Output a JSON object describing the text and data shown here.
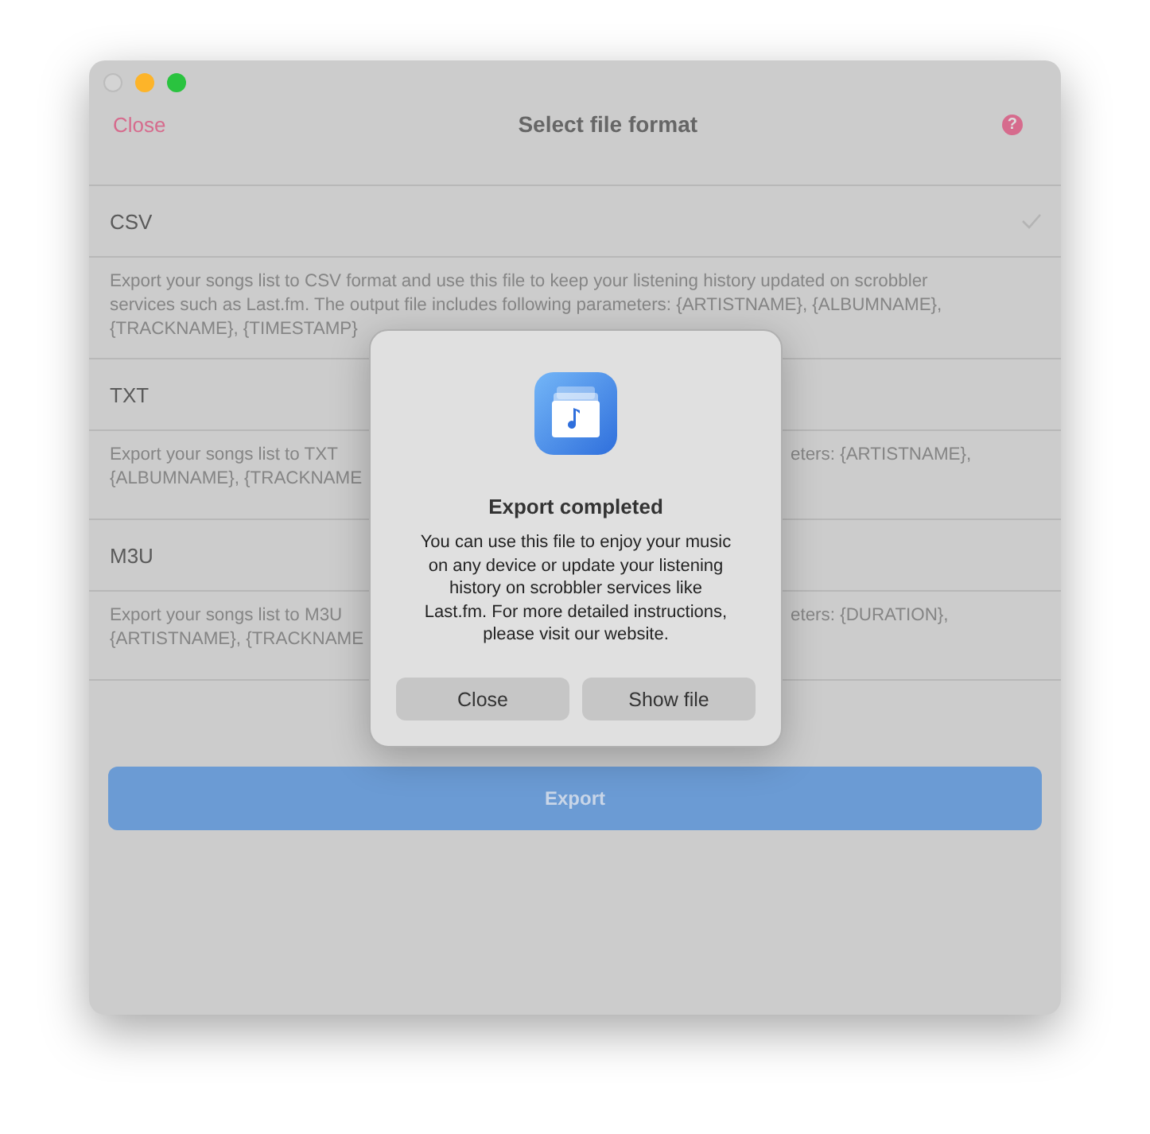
{
  "window": {
    "title": "Select file format",
    "close_label": "Close",
    "help_label": "?"
  },
  "formats": [
    {
      "name": "CSV",
      "selected": true,
      "description_lines": [
        {
          "left": "Export your songs list to CSV format and use this file to keep your listening history updated on scrobbler"
        },
        {
          "left": "services such as Last.fm. The output file includes following parameters: {ARTISTNAME}, {ALBUMNAME},"
        },
        {
          "left": "{TRACKNAME}, {TIMESTAMP}"
        }
      ]
    },
    {
      "name": "TXT",
      "selected": false,
      "description_lines": [
        {
          "left": "Export your songs list to TXT",
          "right": "eters: {ARTISTNAME},"
        },
        {
          "left": "{ALBUMNAME}, {TRACKNAME"
        }
      ]
    },
    {
      "name": "M3U",
      "selected": false,
      "description_lines": [
        {
          "left": "Export your songs list to M3U",
          "right": "eters: {DURATION},"
        },
        {
          "left": "{ARTISTNAME}, {TRACKNAME"
        }
      ]
    }
  ],
  "export_button": "Export",
  "dialog": {
    "title": "Export completed",
    "message": "You can use this file to enjoy your music on any device or update your listening history on scrobbler services like Last.fm. For more detailed instructions, please visit our website.",
    "buttons": [
      "Close",
      "Show file"
    ]
  }
}
